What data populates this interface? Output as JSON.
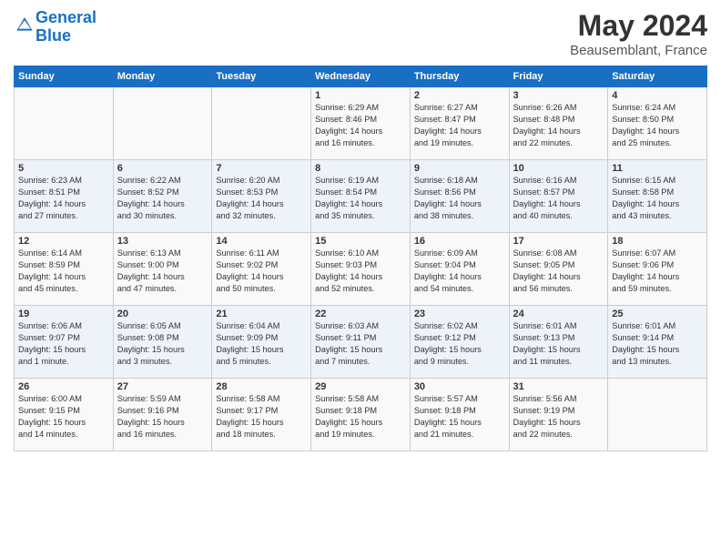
{
  "header": {
    "logo_line1": "General",
    "logo_line2": "Blue",
    "month": "May 2024",
    "location": "Beausemblant, France"
  },
  "days_of_week": [
    "Sunday",
    "Monday",
    "Tuesday",
    "Wednesday",
    "Thursday",
    "Friday",
    "Saturday"
  ],
  "weeks": [
    [
      {
        "day": "",
        "info": ""
      },
      {
        "day": "",
        "info": ""
      },
      {
        "day": "",
        "info": ""
      },
      {
        "day": "1",
        "info": "Sunrise: 6:29 AM\nSunset: 8:46 PM\nDaylight: 14 hours\nand 16 minutes."
      },
      {
        "day": "2",
        "info": "Sunrise: 6:27 AM\nSunset: 8:47 PM\nDaylight: 14 hours\nand 19 minutes."
      },
      {
        "day": "3",
        "info": "Sunrise: 6:26 AM\nSunset: 8:48 PM\nDaylight: 14 hours\nand 22 minutes."
      },
      {
        "day": "4",
        "info": "Sunrise: 6:24 AM\nSunset: 8:50 PM\nDaylight: 14 hours\nand 25 minutes."
      }
    ],
    [
      {
        "day": "5",
        "info": "Sunrise: 6:23 AM\nSunset: 8:51 PM\nDaylight: 14 hours\nand 27 minutes."
      },
      {
        "day": "6",
        "info": "Sunrise: 6:22 AM\nSunset: 8:52 PM\nDaylight: 14 hours\nand 30 minutes."
      },
      {
        "day": "7",
        "info": "Sunrise: 6:20 AM\nSunset: 8:53 PM\nDaylight: 14 hours\nand 32 minutes."
      },
      {
        "day": "8",
        "info": "Sunrise: 6:19 AM\nSunset: 8:54 PM\nDaylight: 14 hours\nand 35 minutes."
      },
      {
        "day": "9",
        "info": "Sunrise: 6:18 AM\nSunset: 8:56 PM\nDaylight: 14 hours\nand 38 minutes."
      },
      {
        "day": "10",
        "info": "Sunrise: 6:16 AM\nSunset: 8:57 PM\nDaylight: 14 hours\nand 40 minutes."
      },
      {
        "day": "11",
        "info": "Sunrise: 6:15 AM\nSunset: 8:58 PM\nDaylight: 14 hours\nand 43 minutes."
      }
    ],
    [
      {
        "day": "12",
        "info": "Sunrise: 6:14 AM\nSunset: 8:59 PM\nDaylight: 14 hours\nand 45 minutes."
      },
      {
        "day": "13",
        "info": "Sunrise: 6:13 AM\nSunset: 9:00 PM\nDaylight: 14 hours\nand 47 minutes."
      },
      {
        "day": "14",
        "info": "Sunrise: 6:11 AM\nSunset: 9:02 PM\nDaylight: 14 hours\nand 50 minutes."
      },
      {
        "day": "15",
        "info": "Sunrise: 6:10 AM\nSunset: 9:03 PM\nDaylight: 14 hours\nand 52 minutes."
      },
      {
        "day": "16",
        "info": "Sunrise: 6:09 AM\nSunset: 9:04 PM\nDaylight: 14 hours\nand 54 minutes."
      },
      {
        "day": "17",
        "info": "Sunrise: 6:08 AM\nSunset: 9:05 PM\nDaylight: 14 hours\nand 56 minutes."
      },
      {
        "day": "18",
        "info": "Sunrise: 6:07 AM\nSunset: 9:06 PM\nDaylight: 14 hours\nand 59 minutes."
      }
    ],
    [
      {
        "day": "19",
        "info": "Sunrise: 6:06 AM\nSunset: 9:07 PM\nDaylight: 15 hours\nand 1 minute."
      },
      {
        "day": "20",
        "info": "Sunrise: 6:05 AM\nSunset: 9:08 PM\nDaylight: 15 hours\nand 3 minutes."
      },
      {
        "day": "21",
        "info": "Sunrise: 6:04 AM\nSunset: 9:09 PM\nDaylight: 15 hours\nand 5 minutes."
      },
      {
        "day": "22",
        "info": "Sunrise: 6:03 AM\nSunset: 9:11 PM\nDaylight: 15 hours\nand 7 minutes."
      },
      {
        "day": "23",
        "info": "Sunrise: 6:02 AM\nSunset: 9:12 PM\nDaylight: 15 hours\nand 9 minutes."
      },
      {
        "day": "24",
        "info": "Sunrise: 6:01 AM\nSunset: 9:13 PM\nDaylight: 15 hours\nand 11 minutes."
      },
      {
        "day": "25",
        "info": "Sunrise: 6:01 AM\nSunset: 9:14 PM\nDaylight: 15 hours\nand 13 minutes."
      }
    ],
    [
      {
        "day": "26",
        "info": "Sunrise: 6:00 AM\nSunset: 9:15 PM\nDaylight: 15 hours\nand 14 minutes."
      },
      {
        "day": "27",
        "info": "Sunrise: 5:59 AM\nSunset: 9:16 PM\nDaylight: 15 hours\nand 16 minutes."
      },
      {
        "day": "28",
        "info": "Sunrise: 5:58 AM\nSunset: 9:17 PM\nDaylight: 15 hours\nand 18 minutes."
      },
      {
        "day": "29",
        "info": "Sunrise: 5:58 AM\nSunset: 9:18 PM\nDaylight: 15 hours\nand 19 minutes."
      },
      {
        "day": "30",
        "info": "Sunrise: 5:57 AM\nSunset: 9:18 PM\nDaylight: 15 hours\nand 21 minutes."
      },
      {
        "day": "31",
        "info": "Sunrise: 5:56 AM\nSunset: 9:19 PM\nDaylight: 15 hours\nand 22 minutes."
      },
      {
        "day": "",
        "info": ""
      }
    ]
  ]
}
